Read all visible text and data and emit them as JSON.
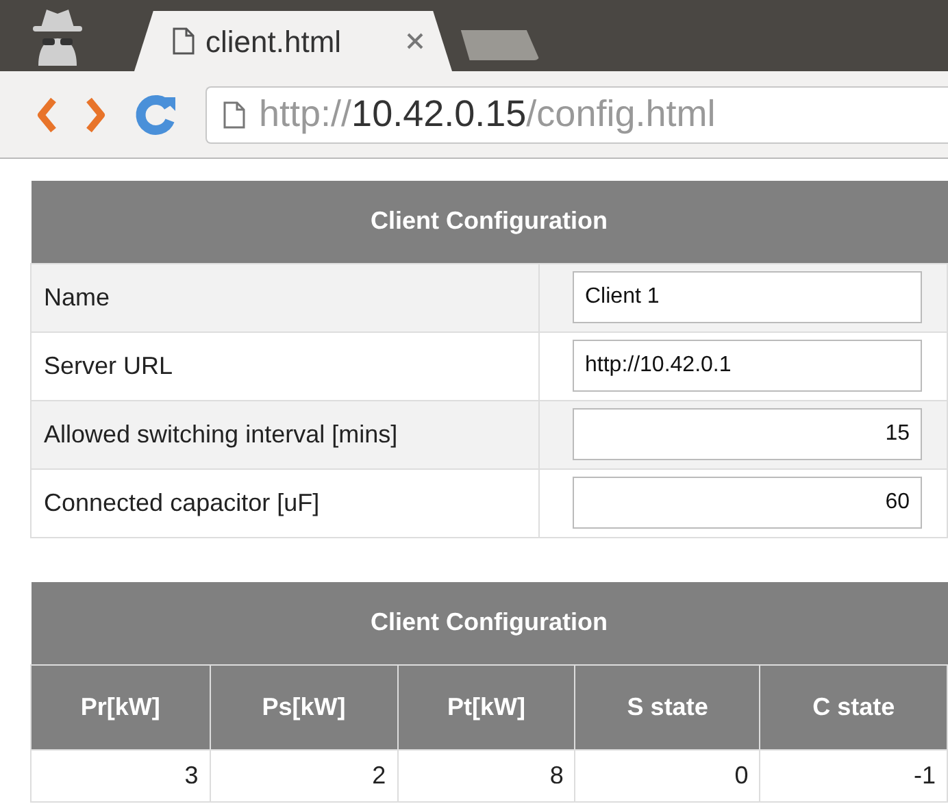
{
  "browser": {
    "tab": {
      "title": "client.html",
      "selected": true
    },
    "address": {
      "scheme": "http://",
      "host": "10.42.0.15",
      "path": "/config.html"
    }
  },
  "config_table": {
    "title": "Client Configuration",
    "rows": [
      {
        "label": "Name",
        "value": "Client 1",
        "kind": "text"
      },
      {
        "label": "Server URL",
        "value": "http://10.42.0.1",
        "kind": "text"
      },
      {
        "label": "Allowed switching interval [mins]",
        "value": "15",
        "kind": "number"
      },
      {
        "label": "Connected capacitor [uF]",
        "value": "60",
        "kind": "number"
      }
    ]
  },
  "status_table": {
    "title": "Client Configuration",
    "columns": [
      "Pr[kW]",
      "Ps[kW]",
      "Pt[kW]",
      "S state",
      "C state"
    ],
    "rows": [
      [
        "3",
        "2",
        "8",
        "0",
        "-1"
      ]
    ]
  }
}
